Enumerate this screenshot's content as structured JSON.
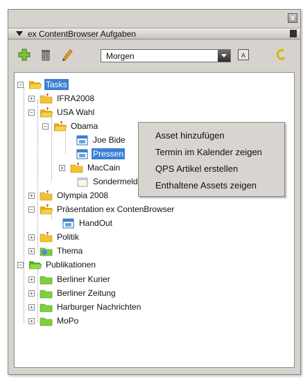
{
  "panel": {
    "title": "ex ContentBrowser Aufgaben",
    "close_glyph": "x"
  },
  "toolbar": {
    "add_icon": "plus-icon",
    "delete_icon": "trash-icon",
    "edit_icon": "pencil-icon",
    "combo_value": "Morgen",
    "filter_icon": "calendar-icon",
    "refresh_icon": "refresh-icon"
  },
  "tree": {
    "tasks": "Tasks",
    "ifra": "IFRA2008",
    "usa_wahl": "USA Wahl",
    "obama": "Obama",
    "joe_biden": "Joe Bide",
    "pressen": "Pressen",
    "maccain": "MacCain",
    "sondermeld": "Sondermeld",
    "olympia": "Olympia 2008",
    "praesentation": "Präsentation  ex ContenBrowser",
    "handout": "HandOut",
    "politik": "Politik",
    "thema": "Thema",
    "publikationen": "Publikationen",
    "berliner_kurier": "Berliner Kurier",
    "berliner_zeitung": "Berliner Zeitung",
    "harburger": "Harburger Nachrichten",
    "mopo": "MoPo"
  },
  "context_menu": {
    "items": [
      "Asset hinzufügen",
      "Termin im Kalender zeigen",
      "QPS Artikel erstellen",
      "Enthaltene Assets zeigen"
    ]
  },
  "colors": {
    "selection": "#3c7fd5",
    "panel": "#d6d3ce",
    "task_folder": "#f2c232",
    "publication_folder": "#7fd13b"
  }
}
